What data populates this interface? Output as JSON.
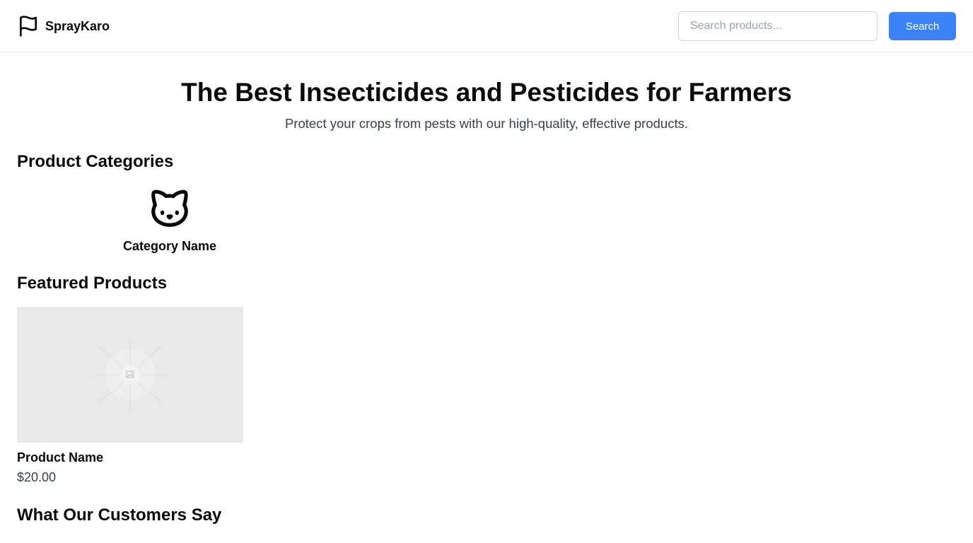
{
  "header": {
    "brand_name": "SprayKaro",
    "brand_icon": "flag-icon",
    "search_placeholder": "Search products...",
    "search_value": "",
    "search_button_label": "Search"
  },
  "hero": {
    "title": "The Best Insecticides and Pesticides for Farmers",
    "subtitle": "Protect your crops from pests with our high-quality, effective products."
  },
  "categories": {
    "title": "Product Categories",
    "items": [
      {
        "icon": "cat-icon",
        "name": "Category Name"
      }
    ]
  },
  "featured": {
    "title": "Featured Products",
    "items": [
      {
        "image": "image-placeholder-icon",
        "name": "Product Name",
        "price": "$20.00"
      }
    ]
  },
  "testimonials": {
    "title": "What Our Customers Say"
  },
  "colors": {
    "accent": "#3b82f6",
    "text": "#0a0a0a",
    "muted_text": "#374151",
    "image_placeholder_bg": "#e9e9e9"
  }
}
